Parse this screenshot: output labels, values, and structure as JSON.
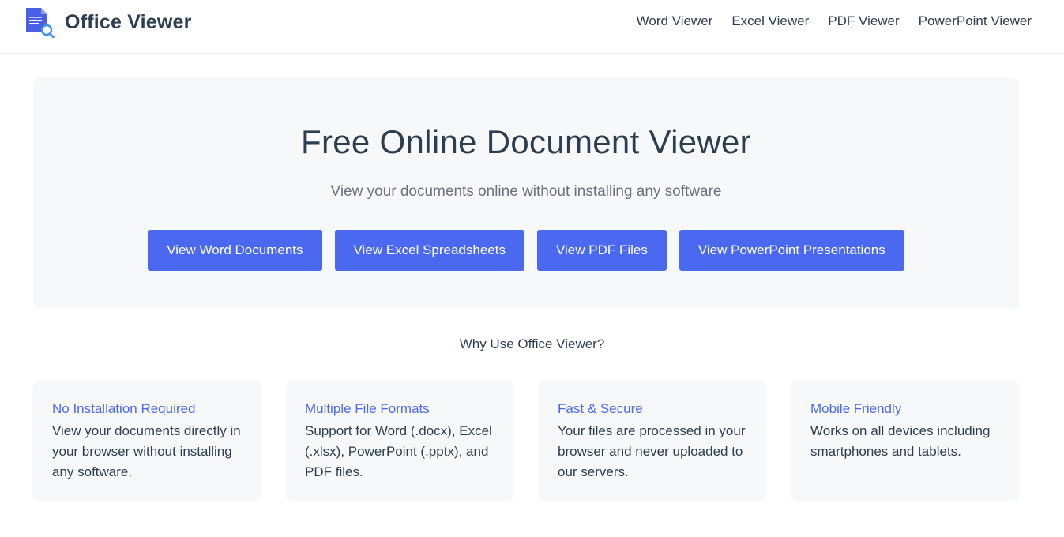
{
  "header": {
    "logo_text": "Office Viewer",
    "nav": [
      "Word Viewer",
      "Excel Viewer",
      "PDF Viewer",
      "PowerPoint Viewer"
    ]
  },
  "hero": {
    "title": "Free Online Document Viewer",
    "subtitle": "View your documents online without installing any software",
    "buttons": [
      "View Word Documents",
      "View Excel Spreadsheets",
      "View PDF Files",
      "View PowerPoint Presentations"
    ]
  },
  "why_title": "Why Use Office Viewer?",
  "features": [
    {
      "title": "No Installation Required",
      "text": "View your documents directly in your browser without installing any software."
    },
    {
      "title": "Multiple File Formats",
      "text": "Support for Word (.docx), Excel (.xlsx), PowerPoint (.pptx), and PDF files."
    },
    {
      "title": "Fast & Secure",
      "text": "Your files are processed in your browser and never uploaded to our servers."
    },
    {
      "title": "Mobile Friendly",
      "text": "Works on all devices including smartphones and tablets."
    }
  ],
  "colors": {
    "accent": "#4a69f0",
    "text": "#2c3e50",
    "panel": "#f7f8fa"
  },
  "icons": {
    "logo": "document-search-icon"
  }
}
